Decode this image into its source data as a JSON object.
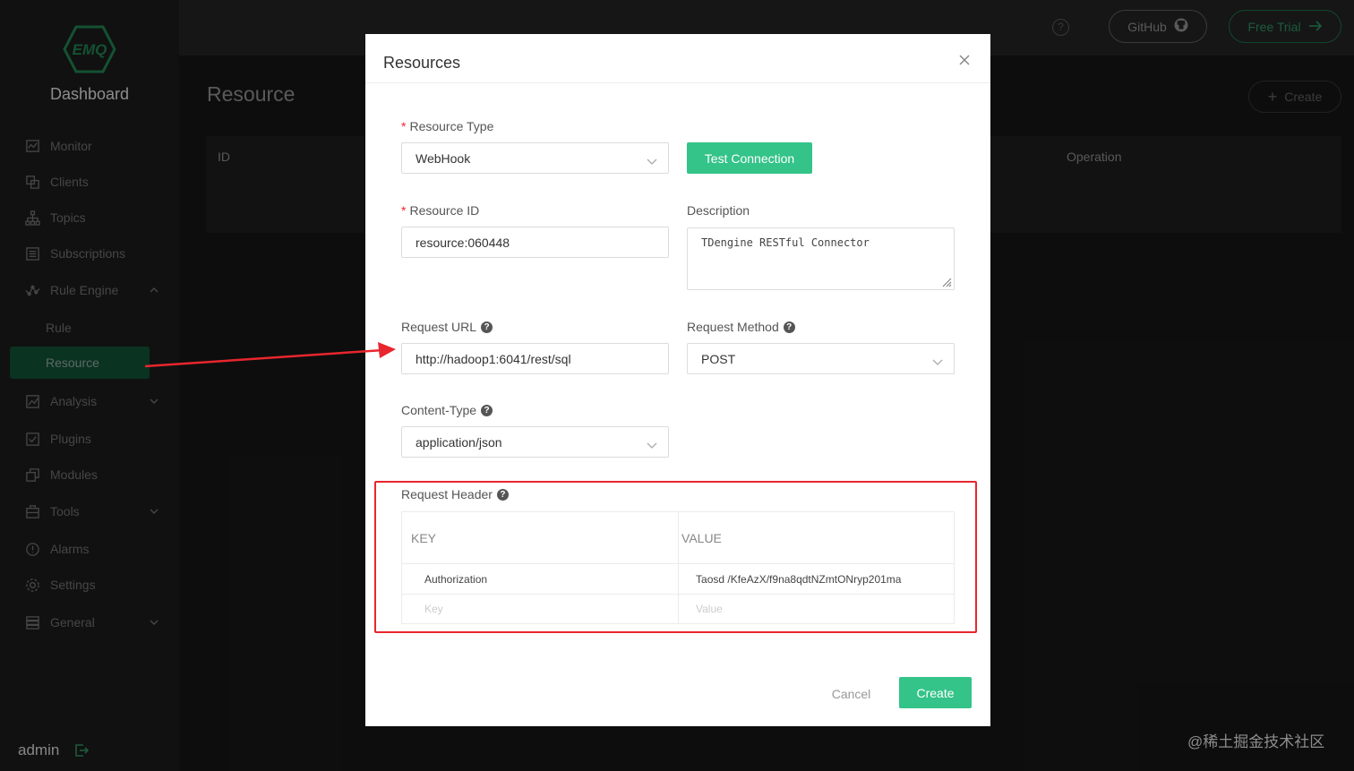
{
  "sidebar": {
    "logo_text": "EMQ",
    "brand": "Dashboard",
    "items": [
      {
        "label": "Monitor",
        "icon": "monitor-icon"
      },
      {
        "label": "Clients",
        "icon": "clients-icon"
      },
      {
        "label": "Topics",
        "icon": "topics-icon"
      },
      {
        "label": "Subscriptions",
        "icon": "subscriptions-icon"
      },
      {
        "label": "Rule Engine",
        "icon": "rule-engine-icon"
      },
      {
        "label": "Rule"
      },
      {
        "label": "Resource"
      },
      {
        "label": "Analysis",
        "icon": "analysis-icon"
      },
      {
        "label": "Plugins",
        "icon": "plugins-icon"
      },
      {
        "label": "Modules",
        "icon": "modules-icon"
      },
      {
        "label": "Tools",
        "icon": "tools-icon"
      },
      {
        "label": "Alarms",
        "icon": "alarms-icon"
      },
      {
        "label": "Settings",
        "icon": "settings-icon"
      },
      {
        "label": "General",
        "icon": "general-icon"
      }
    ],
    "user": "admin"
  },
  "topbar": {
    "github": "GitHub",
    "free_trial": "Free Trial",
    "help": "?"
  },
  "main": {
    "title": "Resource",
    "create": "Create",
    "columns": [
      "ID",
      "Operation"
    ]
  },
  "modal": {
    "title": "Resources",
    "resource_type": {
      "label": "Resource Type",
      "value": "WebHook"
    },
    "test_connection": "Test Connection",
    "resource_id": {
      "label": "Resource ID",
      "value": "resource:060448"
    },
    "description": {
      "label": "Description",
      "value": "TDengine RESTful Connector"
    },
    "request_url": {
      "label": "Request URL",
      "value": "http://hadoop1:6041/rest/sql"
    },
    "request_method": {
      "label": "Request Method",
      "value": "POST"
    },
    "content_type": {
      "label": "Content-Type",
      "value": "application/json"
    },
    "request_header": {
      "label": "Request Header",
      "col_key": "KEY",
      "col_value": "VALUE",
      "rows": [
        {
          "key": "Authorization",
          "value": "Taosd /KfeAzX/f9na8qdtNZmtONryp201ma"
        }
      ],
      "key_placeholder": "Key",
      "value_placeholder": "Value"
    },
    "cancel": "Cancel",
    "create": "Create"
  },
  "colors": {
    "accent": "#34c388",
    "sidebar_active": "#104f34",
    "annotation": "#e8262d"
  },
  "watermark": "@稀土掘金技术社区"
}
